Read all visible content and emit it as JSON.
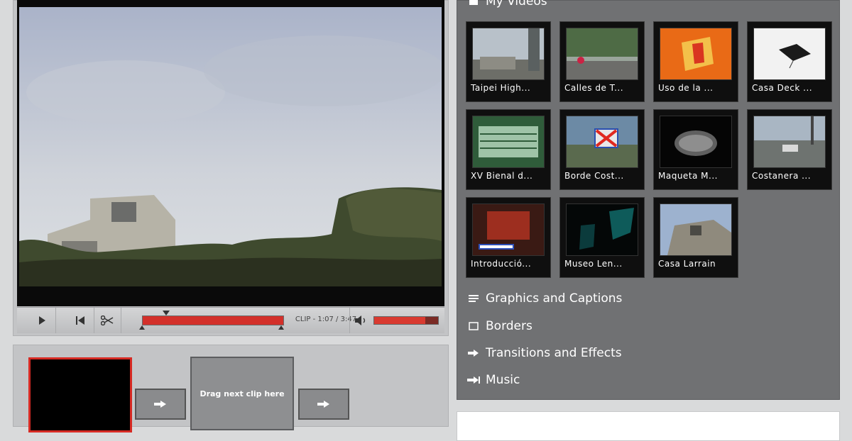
{
  "player": {
    "time_text": "CLIP - 1:07 / 3:47",
    "progress": 0.32,
    "volume": 0.8,
    "icons": [
      "play-icon",
      "skip-back-icon",
      "scissors-icon",
      "volume-icon"
    ]
  },
  "storyboard": {
    "drop_label": "Drag next clip here"
  },
  "library": {
    "title": "My Videos",
    "videos": [
      {
        "caption": "Taipei High..."
      },
      {
        "caption": "Calles de T..."
      },
      {
        "caption": "Uso de la ..."
      },
      {
        "caption": "Casa Deck ..."
      },
      {
        "caption": "XV Bienal d..."
      },
      {
        "caption": "Borde Cost..."
      },
      {
        "caption": "Maqueta M..."
      },
      {
        "caption": "Costanera ..."
      },
      {
        "caption": "Introducció..."
      },
      {
        "caption": "Museo Len..."
      },
      {
        "caption": "Casa Larrain"
      }
    ],
    "sections": [
      {
        "label": "Graphics and Captions"
      },
      {
        "label": "Borders"
      },
      {
        "label": "Transitions and Effects"
      },
      {
        "label": "Music"
      }
    ]
  },
  "colors": {
    "accent": "#d3302a",
    "panel": "#707173"
  }
}
